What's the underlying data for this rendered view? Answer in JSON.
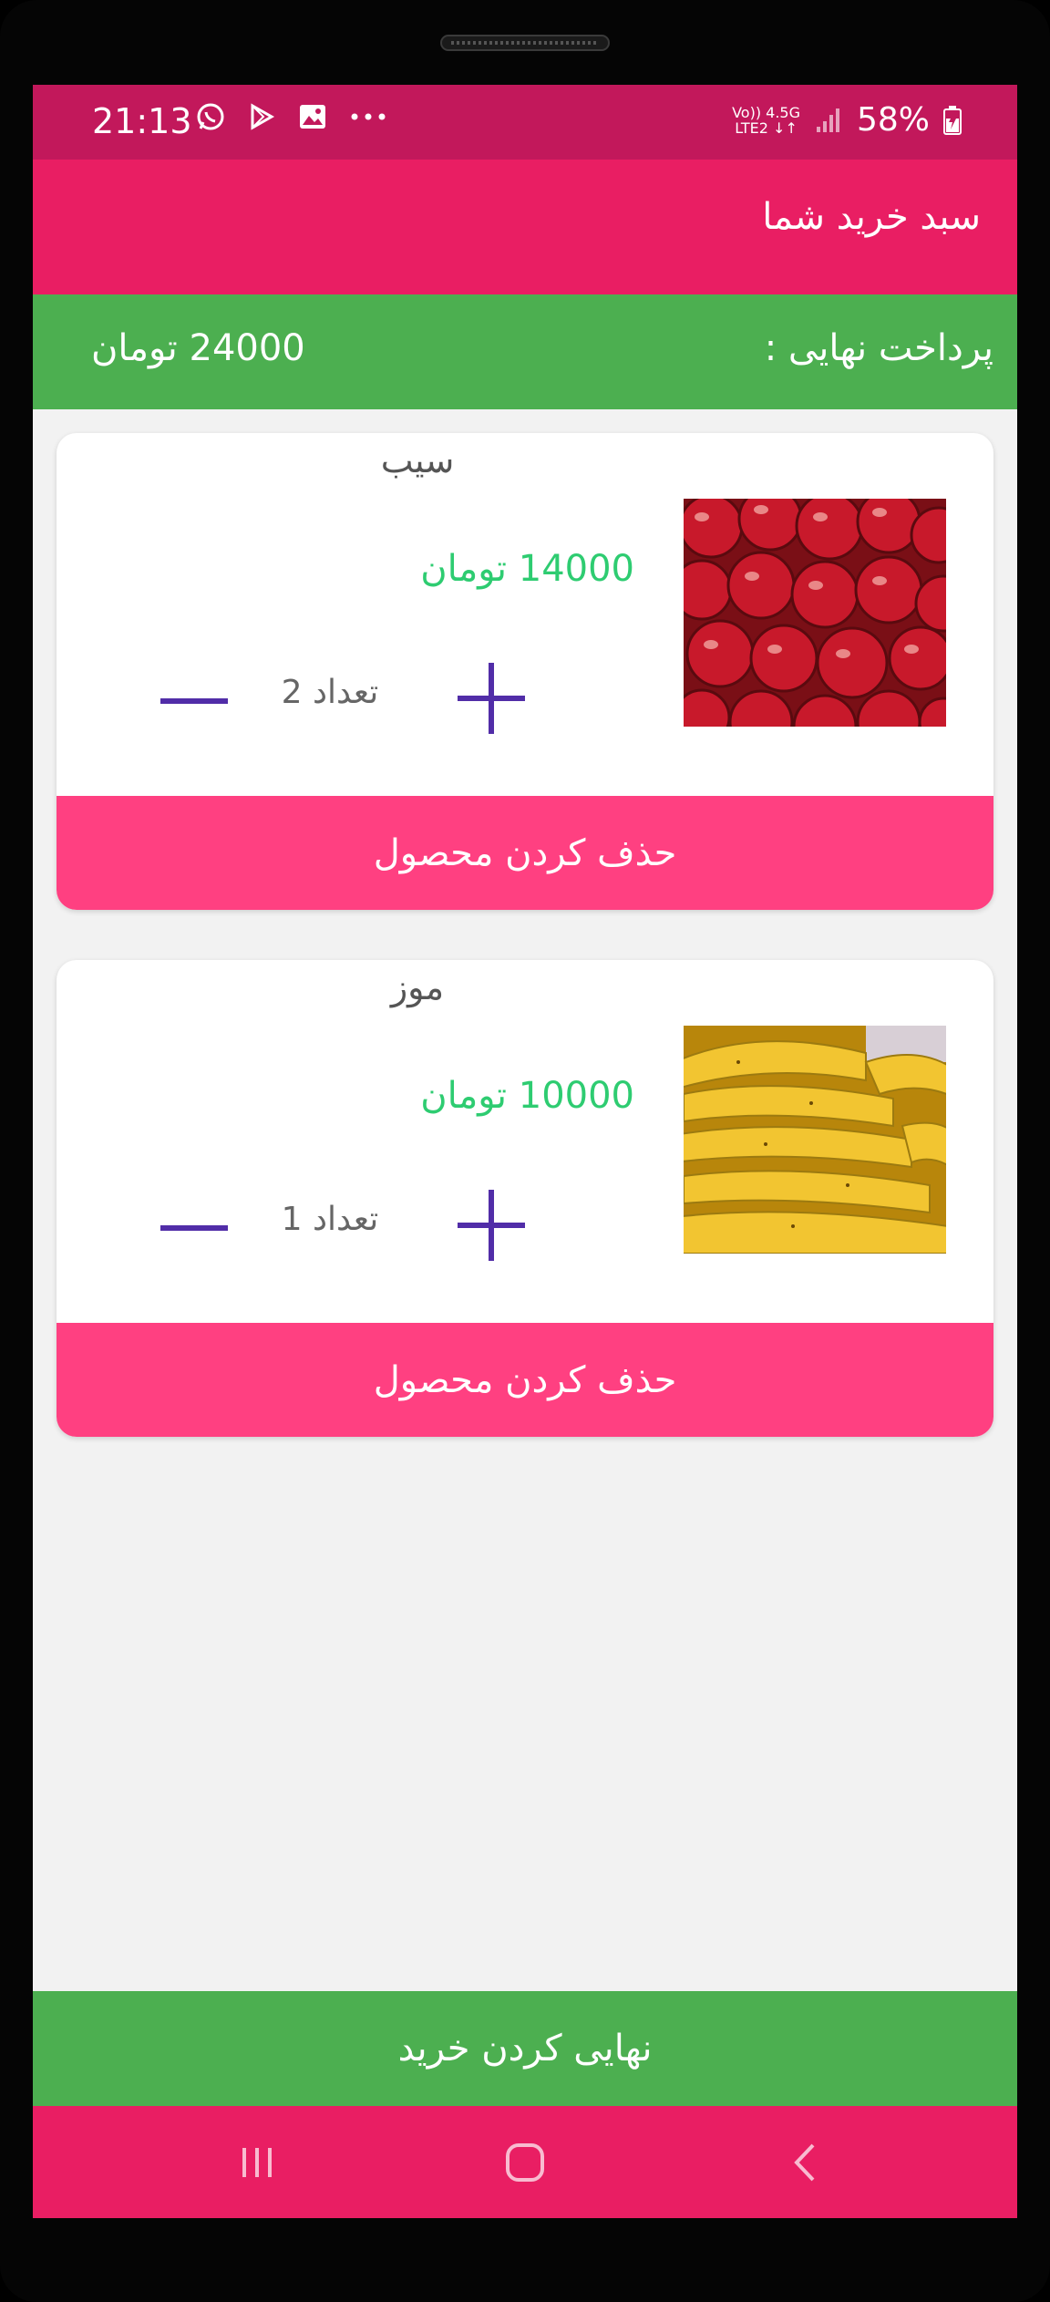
{
  "status_bar": {
    "time": "21:13",
    "network_top": "Vo))  4.5G",
    "network_bottom": "LTE2  ↓↑",
    "battery": "58%",
    "icons": [
      "whatsapp-icon",
      "play-store-icon",
      "gallery-icon",
      "more-dots-icon",
      "signal-icon",
      "battery-icon"
    ]
  },
  "app_bar": {
    "title": "سبد خرید شما"
  },
  "total": {
    "label": "پرداخت نهایی :",
    "value": "24000 تومان"
  },
  "cart_items": [
    {
      "name": "سیب",
      "price": "14000 تومان",
      "quantity": "تعداد 2",
      "image": "apples-photo",
      "delete_label": "حذف کردن محصول"
    },
    {
      "name": "موز",
      "price": "10000 تومان",
      "quantity": "تعداد 1",
      "image": "bananas-photo",
      "delete_label": "حذف کردن محصول"
    }
  ],
  "finalize_label": "نهایی کردن خرید",
  "nav_bar": {
    "icons": [
      "recents-icon",
      "home-icon",
      "back-icon"
    ]
  },
  "colors": {
    "status_bar": "#c2185b",
    "app_bar": "#e91e63",
    "total_bar": "#4caf50",
    "delete_button": "#ff4081",
    "price_text": "#2ecc71",
    "stepper": "#512da8"
  }
}
